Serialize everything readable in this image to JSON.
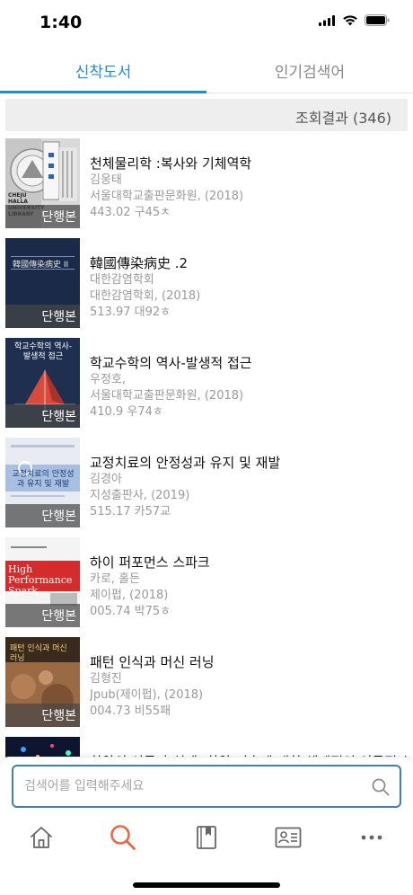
{
  "status_bar": {
    "time": "1:40"
  },
  "tabs": [
    {
      "label": "신착도서",
      "active": true
    },
    {
      "label": "인기검색어",
      "active": false
    }
  ],
  "colors": {
    "accent": "#1f8fd1",
    "search_border": "#3e7fbe",
    "nav_active": "#e8693f",
    "nav_inactive": "#666666"
  },
  "result_summary": "조회결과 (346)",
  "books": [
    {
      "title": "천체물리학 :복사와 기체역학",
      "line1": "김웅태",
      "line2": "서울대학교출판문화원, (2018)",
      "call_no": "443.02 구45ㅊ",
      "badge": "단행본",
      "cover_text": "CHEJU HALLA UNIVERSITY LIBRARY"
    },
    {
      "title": "韓國傳染病史 .2",
      "line1": "대한감염학회",
      "line2": "대한감염학회, (2018)",
      "call_no": "513.97 대92ㅎ",
      "badge": "단행본",
      "cover_text": "韓國傳染病史 II"
    },
    {
      "title": "학교수학의 역사-발생적 접근",
      "line1": "우정호,",
      "line2": "서울대학교출판문화원, (2018)",
      "call_no": "410.9 우74ㅎ",
      "badge": "단행본",
      "cover_text": "학교수학의 역사-발생적 접근"
    },
    {
      "title": "교정치료의 안정성과 유지 및 재발",
      "line1": "김경아",
      "line2": "지성출판사, (2019)",
      "call_no": "515.17 카57교",
      "badge": "단행본",
      "cover_text": "교정치료의 안정성과 유지 및 재발"
    },
    {
      "title": "하이 퍼포먼스 스파크",
      "line1": "카로, 홀든",
      "line2": "제이펍, (2018)",
      "call_no": "005.74 박75ㅎ",
      "badge": "단행본",
      "cover_text": "High Performance Spark"
    },
    {
      "title": "패턴 인식과 머신 러닝",
      "line1": "김형진",
      "line2": "Jpub(제이펍), (2018)",
      "call_no": "004.73 비55패",
      "badge": "단행본",
      "cover_text": "패턴 인식과 머신 러닝"
    },
    {
      "title": "확약의 이론과 실제 :확약 기술에 대한 체계적인 이론적 실",
      "line1": "",
      "line2": "",
      "call_no": "",
      "badge": "",
      "cover_text": ""
    }
  ],
  "search": {
    "placeholder": "검색어를 입력해주세요",
    "value": ""
  },
  "bottom_nav": [
    {
      "icon": "home-icon",
      "active": false
    },
    {
      "icon": "search-icon",
      "active": true
    },
    {
      "icon": "bookmark-book-icon",
      "active": false
    },
    {
      "icon": "id-card-icon",
      "active": false
    },
    {
      "icon": "more-icon",
      "active": false
    }
  ]
}
